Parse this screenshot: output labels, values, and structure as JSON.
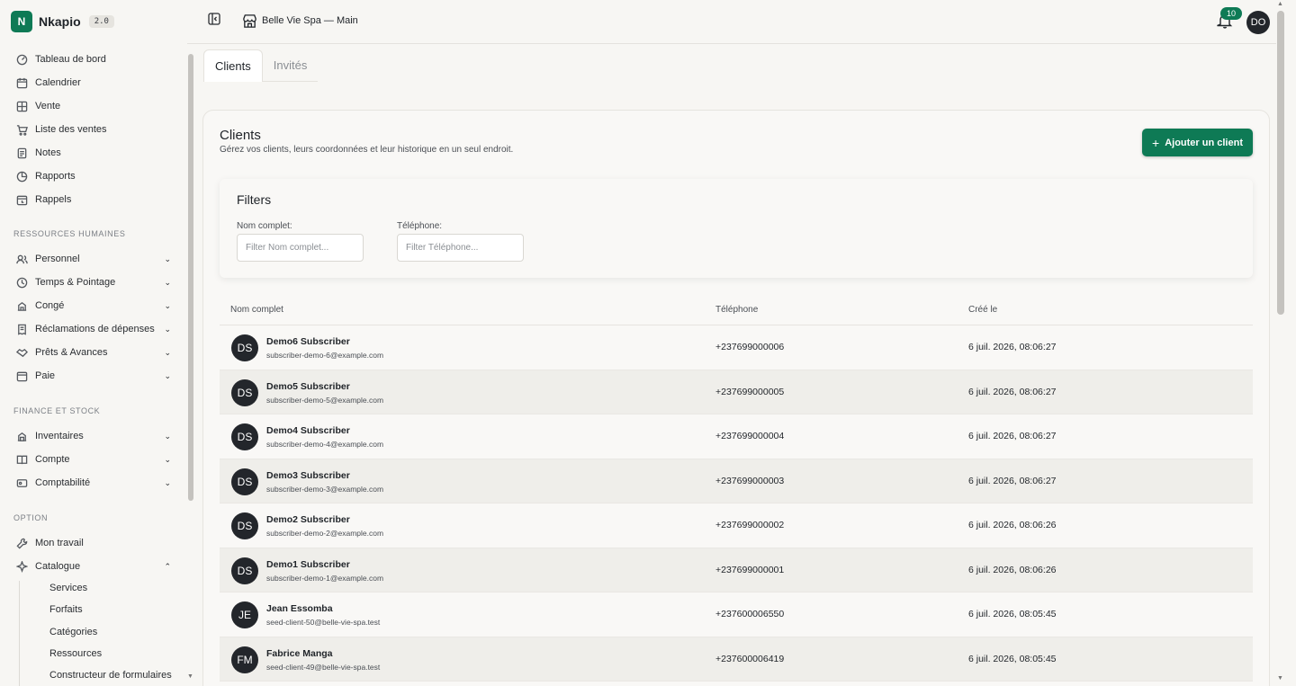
{
  "brand": {
    "logo_letter": "N",
    "name": "Nkapio",
    "version": "2.0",
    "accent": "#0e7a55"
  },
  "header": {
    "location": "Belle Vie Spa — Main",
    "notification_count": "10",
    "user_initials": "DO"
  },
  "sidebar": {
    "main_items": [
      {
        "label": "Tableau de bord",
        "icon": "dashboard-icon"
      },
      {
        "label": "Calendrier",
        "icon": "calendar-icon"
      },
      {
        "label": "Vente",
        "icon": "grid-icon"
      },
      {
        "label": "Liste des ventes",
        "icon": "cart-icon"
      },
      {
        "label": "Notes",
        "icon": "note-icon"
      },
      {
        "label": "Rapports",
        "icon": "pie-chart-icon"
      },
      {
        "label": "Rappels",
        "icon": "reminder-icon"
      }
    ],
    "section_hr": "RESSOURCES HUMAINES",
    "hr_items": [
      {
        "label": "Personnel",
        "icon": "users-icon"
      },
      {
        "label": "Temps & Pointage",
        "icon": "clock-icon"
      },
      {
        "label": "Congé",
        "icon": "leave-icon"
      },
      {
        "label": "Réclamations de dépenses",
        "icon": "receipt-icon"
      },
      {
        "label": "Prêts & Avances",
        "icon": "handshake-icon"
      },
      {
        "label": "Paie",
        "icon": "payroll-icon"
      }
    ],
    "section_finance": "FINANCE ET STOCK",
    "finance_items": [
      {
        "label": "Inventaires",
        "icon": "inventory-icon"
      },
      {
        "label": "Compte",
        "icon": "book-icon"
      },
      {
        "label": "Comptabilité",
        "icon": "accounting-icon"
      }
    ],
    "section_option": "OPTION",
    "option_items": [
      {
        "label": "Mon travail",
        "icon": "wrench-icon"
      },
      {
        "label": "Catalogue",
        "icon": "sparkles-icon"
      }
    ],
    "catalogue_sub": [
      "Services",
      "Forfaits",
      "Catégories",
      "Ressources",
      "Constructeur de formulaires"
    ]
  },
  "tabs": [
    "Clients",
    "Invités"
  ],
  "main": {
    "title": "Clients",
    "subtitle": "Gérez vos clients, leurs coordonnées et leur historique en un seul endroit.",
    "add_button": "Ajouter un client"
  },
  "filters": {
    "title": "Filters",
    "name_label": "Nom complet:",
    "name_placeholder": "Filter Nom complet...",
    "phone_label": "Téléphone:",
    "phone_placeholder": "Filter Téléphone..."
  },
  "table": {
    "columns": [
      "Nom complet",
      "Téléphone",
      "Créé le"
    ],
    "rows": [
      {
        "initials": "DS",
        "name": "Demo6 Subscriber",
        "email": "subscriber-demo-6@example.com",
        "phone": "+237699000006",
        "created": "6 juil. 2026, 08:06:27"
      },
      {
        "initials": "DS",
        "name": "Demo5 Subscriber",
        "email": "subscriber-demo-5@example.com",
        "phone": "+237699000005",
        "created": "6 juil. 2026, 08:06:27"
      },
      {
        "initials": "DS",
        "name": "Demo4 Subscriber",
        "email": "subscriber-demo-4@example.com",
        "phone": "+237699000004",
        "created": "6 juil. 2026, 08:06:27"
      },
      {
        "initials": "DS",
        "name": "Demo3 Subscriber",
        "email": "subscriber-demo-3@example.com",
        "phone": "+237699000003",
        "created": "6 juil. 2026, 08:06:27"
      },
      {
        "initials": "DS",
        "name": "Demo2 Subscriber",
        "email": "subscriber-demo-2@example.com",
        "phone": "+237699000002",
        "created": "6 juil. 2026, 08:06:26"
      },
      {
        "initials": "DS",
        "name": "Demo1 Subscriber",
        "email": "subscriber-demo-1@example.com",
        "phone": "+237699000001",
        "created": "6 juil. 2026, 08:06:26"
      },
      {
        "initials": "JE",
        "name": "Jean Essomba",
        "email": "seed-client-50@belle-vie-spa.test",
        "phone": "+237600006550",
        "created": "6 juil. 2026, 08:05:45"
      },
      {
        "initials": "FM",
        "name": "Fabrice Manga",
        "email": "seed-client-49@belle-vie-spa.test",
        "phone": "+237600006419",
        "created": "6 juil. 2026, 08:05:45"
      }
    ]
  }
}
